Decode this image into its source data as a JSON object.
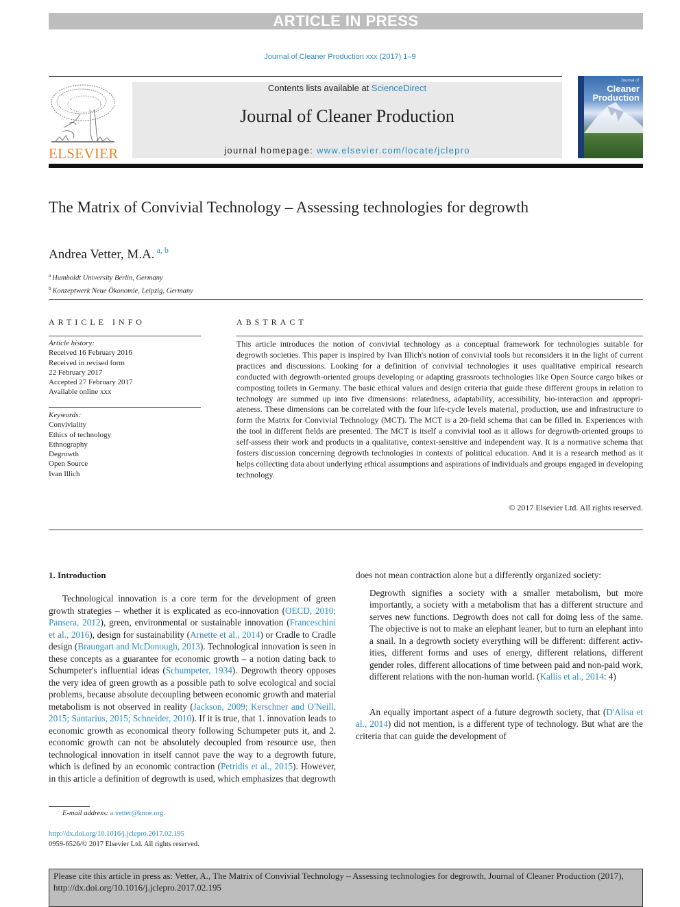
{
  "banner": {
    "label": "ARTICLE IN PRESS"
  },
  "journal_ref": "Journal of Cleaner Production xxx (2017) 1–9",
  "masthead": {
    "contents_prefix": "Contents lists available at ",
    "contents_link": "ScienceDirect",
    "journal_name": "Journal of Cleaner Production",
    "homepage_prefix": "journal homepage: ",
    "homepage_link": "www.elsevier.com/locate/jclepro",
    "publisher_logo_text": "ELSEVIER",
    "cover_title_small": "Journal of",
    "cover_title_line1": "Cleaner",
    "cover_title_line2": "Production"
  },
  "article": {
    "title": "The Matrix of Convivial Technology – Assessing technologies for degrowth",
    "author": "Andrea Vetter, M.A.",
    "author_affil_marks": "a, b",
    "affiliations": [
      {
        "mark": "a",
        "text": "Humboldt University Berlin, Germany"
      },
      {
        "mark": "b",
        "text": "Konzeptwerk Neue Ökonomie, Leipzig, Germany"
      }
    ]
  },
  "article_info": {
    "heading": "ARTICLE INFO",
    "history_label": "Article history:",
    "history": [
      "Received 16 February 2016",
      "Received in revised form",
      "22 February 2017",
      "Accepted 27 February 2017",
      "Available online xxx"
    ],
    "keywords_label": "Keywords:",
    "keywords": [
      "Conviviality",
      "Ethics of technology",
      "Ethnography",
      "Degrowth",
      "Open Source",
      "Ivan Illich"
    ]
  },
  "abstract": {
    "heading": "ABSTRACT",
    "text": "This article introduces the notion of convivial technology as a conceptual framework for technologies suitable for degrowth societies. This paper is inspired by Ivan Illich's notion of convivial tools but re­considers it in the light of current practices and discussions. Looking for a definition of convivial tech­nologies it uses qualitative empirical research conducted with degrowth-oriented groups developing or adapting grassroots technologies like Open Source cargo bikes or composting toilets in Germany. The basic ethical values and design criteria that guide these different groups in relation to technology are summed up into five dimensions: relatedness, adaptability, accessibility, bio-interaction and appropri­ateness. These dimensions can be correlated with the four life-cycle levels material, production, use and infrastructure to form the Matrix for Convivial Technology (MCT). The MCT is a 20-field schema that can be filled in. Experiences with the tool in different fields are presented. The MCT is itself a convivial tool as it allows for degrowth-oriented groups to self-assess their work and products in a qualitative, context-sensitive and independent way. It is a normative schema that fosters discussion concerning degrowth technologies in contexts of political education. And it is a research method as it helps collecting data about underlying ethical assumptions and aspirations of individuals and groups engaged in developing technology.",
    "copyright": "© 2017 Elsevier Ltd. All rights reserved."
  },
  "intro": {
    "heading": "1.  Introduction",
    "p1": [
      {
        "t": "Technological innovation is a core term for the development of green growth strategies – whether it is explicated as eco-innovation ("
      },
      {
        "t": "OECD, 2010; Pansera, 2012",
        "link": true
      },
      {
        "t": "), green, environmental or sustainable innovation ("
      },
      {
        "t": "Franceschini et al., 2016",
        "link": true
      },
      {
        "t": "), design for sus­tainability ("
      },
      {
        "t": "Arnette et al., 2014",
        "link": true
      },
      {
        "t": ") or Cradle to Cradle design ("
      },
      {
        "t": "Braungart and McDonough, 2013",
        "link": true
      },
      {
        "t": "). Technological innovation is seen in these concepts as a guarantee for economic growth – a notion dating back to Schumpeter's influential ideas ("
      },
      {
        "t": "Schumpeter, 1934",
        "link": true
      },
      {
        "t": "). Degrowth theory opposes the very idea of green growth as a possible path to solve ecological and social problems, because absolute decoupling between economic growth and material metabolism is not observed in reality ("
      },
      {
        "t": "Jackson, 2009; Kerschner and O'Neill, 2015; Santarius, 2015; Schneider, 2010",
        "link": true
      },
      {
        "t": "). If it is true, that 1. innovation leads to economic growth as economical theory following Schumpeter puts it, and 2. economic growth can not be absolutely decoupled from resource use, then technological innovation in itself cannot pave the way to a degrowth future, which is defined by an economic contraction ("
      },
      {
        "t": "Petridis et al., 2015",
        "link": true
      },
      {
        "t": "). However, in this article a definition of degrowth is used, which emphasizes that degrowth does not mean contraction alone but a differently organized society:"
      }
    ],
    "quote": [
      {
        "t": "Degrowth signifies a society with a smaller metabolism, but more importantly, a society with a metabolism that has a different structure and serves new functions. Degrowth does not call for doing less of the same. The objective is not to make an elephant leaner, but to turn an elephant into a snail. In a degrowth society everything will be different: different activ­ities, different forms and uses of energy, different relations, different gender roles, different allocations of time between paid and non-paid work, different relations with the non-human world. ("
      },
      {
        "t": "Kallis et al., 2014",
        "link": true
      },
      {
        "t": ": 4)"
      }
    ],
    "p3": [
      {
        "t": "An equally important aspect of a future degrowth society, that ("
      },
      {
        "t": "D'Alisa et al., 2014",
        "link": true
      },
      {
        "t": ") did not mention, is a different type of tech­nology. But what are the criteria that can guide the development of"
      }
    ]
  },
  "footnotes": {
    "email_label": "E-mail address: ",
    "email": "a.vetter@knoe.org",
    "email_suffix": ".",
    "doi": "http://dx.doi.org/10.1016/j.jclepro.2017.02.195",
    "issn": "0959-6526/© 2017 Elsevier Ltd. All rights reserved."
  },
  "cite_box": {
    "text": "Please cite this article in press as: Vetter, A., The Matrix of Convivial Technology – Assessing technologies for degrowth, Journal of Cleaner Production (2017), http://dx.doi.org/10.1016/j.jclepro.2017.02.195"
  },
  "colors": {
    "link": "#2a8bbf",
    "elsevier_orange": "#f07f1e",
    "banner_gray": "#bdbdbd",
    "masthead_gray": "#e9e9e9"
  }
}
